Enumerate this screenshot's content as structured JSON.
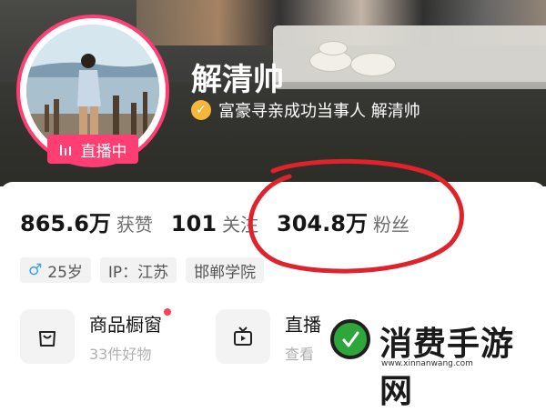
{
  "profile": {
    "live_label": "直播中",
    "name": "解清帅",
    "verification": "富豪寻亲成功当事人 解清帅"
  },
  "stats": [
    {
      "value": "865.6万",
      "label": "获赞"
    },
    {
      "value": "101",
      "label": "关注"
    },
    {
      "value": "304.8万",
      "label": "粉丝"
    }
  ],
  "tags": {
    "gender_symbol": "♂",
    "age": "25岁",
    "ip": "IP：江苏",
    "school": "邯郸学院"
  },
  "entries": {
    "shop_title": "商品橱窗",
    "shop_sub": "33件好物",
    "live_title": "直播",
    "live_sub": "查看"
  },
  "watermark": {
    "text": "消费手游网",
    "url": "www.xinnanwang.com"
  },
  "colors": {
    "accent_pink": "#ff3e73",
    "verify_gold": "#f5b73b",
    "annotation_red": "#e0222a",
    "watermark_green": "#2ea63b"
  }
}
